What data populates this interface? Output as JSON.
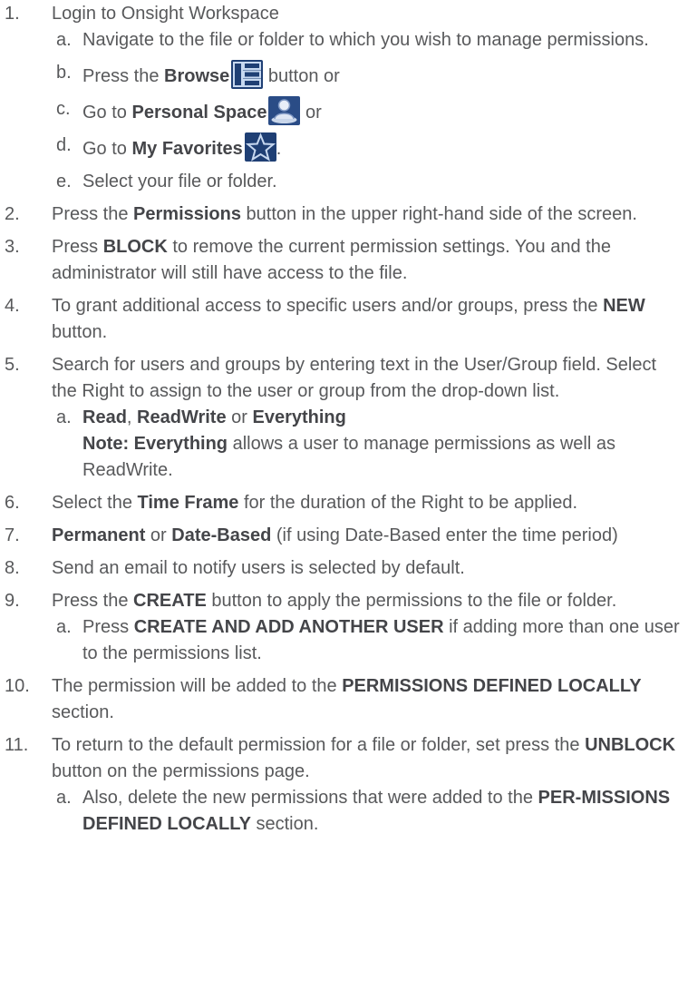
{
  "steps": [
    {
      "num": "1.",
      "segments": [
        {
          "t": "Login to Onsight Workspace"
        }
      ],
      "subs": [
        {
          "letter": "a.",
          "segments": [
            {
              "t": "Navigate to the file or folder to which you wish to manage permissions."
            }
          ]
        },
        {
          "letter": "b.",
          "segments": [
            {
              "t": "Press the "
            },
            {
              "t": "Browse",
              "b": true
            },
            {
              "icon": "browse-icon"
            },
            {
              "t": " button or"
            }
          ]
        },
        {
          "letter": "c.",
          "segments": [
            {
              "t": "Go to "
            },
            {
              "t": "Personal Space",
              "b": true
            },
            {
              "icon": "personal-space-icon"
            },
            {
              "t": " or"
            }
          ]
        },
        {
          "letter": "d.",
          "segments": [
            {
              "t": "Go to "
            },
            {
              "t": "My Favorites",
              "b": true
            },
            {
              "icon": "star-icon"
            },
            {
              "t": "."
            }
          ]
        },
        {
          "letter": "e.",
          "segments": [
            {
              "t": "Select your file or folder."
            }
          ]
        }
      ]
    },
    {
      "num": "2.",
      "segments": [
        {
          "t": "Press the "
        },
        {
          "t": "Permissions",
          "b": true
        },
        {
          "t": " button in the upper right-hand side of the screen."
        }
      ]
    },
    {
      "num": "3.",
      "segments": [
        {
          "t": "Press "
        },
        {
          "t": "BLOCK",
          "b": true
        },
        {
          "t": " to remove the current permission settings. You and the administrator will still have access to the file."
        }
      ]
    },
    {
      "num": "4.",
      "segments": [
        {
          "t": "To grant additional access to specific users and/or groups, press the "
        },
        {
          "t": "NEW",
          "b": true
        },
        {
          "t": " button."
        }
      ]
    },
    {
      "num": "5.",
      "segments": [
        {
          "t": "Search for users and groups by entering text in the User/Group field. Select the Right to assign to the user or group from the drop-down list."
        }
      ],
      "subs": [
        {
          "letter": "a.",
          "segments": [
            {
              "t": "Read",
              "b": true
            },
            {
              "t": ", "
            },
            {
              "t": "ReadWrite",
              "b": true
            },
            {
              "t": " or "
            },
            {
              "t": "Everything",
              "b": true
            },
            {
              "br": true
            },
            {
              "t": "Note: Everything",
              "b": true
            },
            {
              "t": " allows a user to manage permissions as well as ReadWrite."
            }
          ]
        }
      ]
    },
    {
      "num": "6.",
      "gap": true,
      "segments": [
        {
          "t": "Select the "
        },
        {
          "t": "Time Frame",
          "b": true
        },
        {
          "t": " for the duration of the Right to be applied."
        }
      ]
    },
    {
      "num": "7.",
      "segments": [
        {
          "t": "Permanent",
          "b": true
        },
        {
          "t": " or "
        },
        {
          "t": "Date-Based",
          "b": true
        },
        {
          "t": " (if using Date-Based enter the time period)"
        }
      ]
    },
    {
      "num": "8.",
      "segments": [
        {
          "t": "Send an email to notify users is selected by default."
        }
      ]
    },
    {
      "num": "9.",
      "segments": [
        {
          "t": "Press the "
        },
        {
          "t": "CREATE",
          "b": true
        },
        {
          "t": " button to apply the permissions to the file or folder."
        }
      ],
      "subs": [
        {
          "letter": "a.",
          "segments": [
            {
              "t": "Press "
            },
            {
              "t": "CREATE AND ADD ANOTHER USER",
              "b": true
            },
            {
              "t": " if adding more than one user to the permissions list."
            }
          ]
        }
      ]
    },
    {
      "num": "10.",
      "segments": [
        {
          "t": "The permission will be added to the "
        },
        {
          "t": "PERMISSIONS DEFINED LOCALLY",
          "b": true
        },
        {
          "t": " section."
        }
      ]
    },
    {
      "num": "11.",
      "segments": [
        {
          "t": "To return to the default permission for a file or folder, set press the "
        },
        {
          "t": "UNBLOCK",
          "b": true
        },
        {
          "t": " button on the permissions page."
        }
      ],
      "subs": [
        {
          "letter": "a.",
          "segments": [
            {
              "t": "Also, delete the new permissions that were added to the "
            },
            {
              "t": "PER-MISSIONS DEFINED LOCALLY",
              "b": true
            },
            {
              "t": " section."
            }
          ]
        }
      ]
    }
  ],
  "icons": {
    "browse-icon": {
      "bg": "#1f3f74"
    },
    "personal-space-icon": {
      "bg": "#2a4c86"
    },
    "star-icon": {
      "bg": "#1f3f74"
    }
  }
}
